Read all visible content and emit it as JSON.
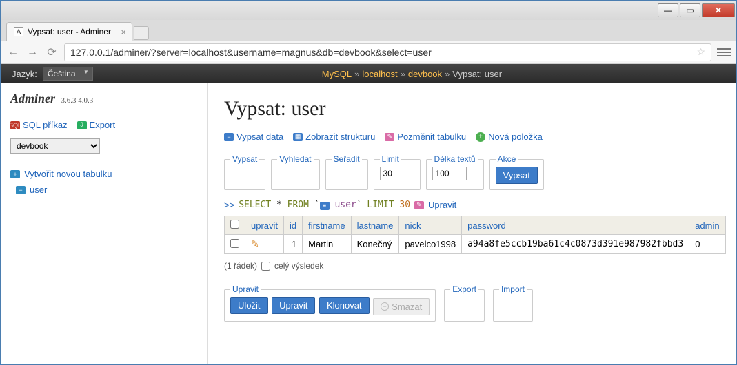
{
  "browser": {
    "tab_title": "Vypsat: user - Adminer",
    "url": "127.0.0.1/adminer/?server=localhost&username=magnus&db=devbook&select=user"
  },
  "topbar": {
    "lang_label": "Jazyk:",
    "lang_value": "Čeština",
    "crumb_mysql": "MySQL",
    "crumb_host": "localhost",
    "crumb_db": "devbook",
    "crumb_current": "Vypsat: user"
  },
  "sidebar": {
    "brand": "Adminer",
    "version": "3.6.3 4.0.3",
    "sql_link": "SQL příkaz",
    "export_link": "Export",
    "db_value": "devbook",
    "create_table": "Vytvořit novou tabulku",
    "table_user": "user"
  },
  "main": {
    "title": "Vypsat: user",
    "act_select": "Vypsat data",
    "act_structure": "Zobrazit strukturu",
    "act_alter": "Pozměnit tabulku",
    "act_new": "Nová položka",
    "fs_select": "Vypsat",
    "fs_search": "Vyhledat",
    "fs_sort": "Seřadit",
    "fs_limit_label": "Limit",
    "fs_limit_value": "30",
    "fs_textlen_label": "Délka textů",
    "fs_textlen_value": "100",
    "fs_action_label": "Akce",
    "fs_action_btn": "Vypsat",
    "sql_prompt": ">>",
    "sql_code_kw1": "SELECT",
    "sql_code_star": "*",
    "sql_code_kw2": "FROM",
    "sql_code_tbl": "user",
    "sql_code_kw3": "LIMIT",
    "sql_code_num": "30",
    "sql_edit": "Upravit",
    "cols": {
      "edit": "upravit",
      "id": "id",
      "firstname": "firstname",
      "lastname": "lastname",
      "nick": "nick",
      "password": "password",
      "admin": "admin"
    },
    "row": {
      "id": "1",
      "firstname": "Martin",
      "lastname": "Konečný",
      "nick": "pavelco1998",
      "password": "a94a8fe5ccb19ba61c4c0873d391e987982fbbd3",
      "admin": "0"
    },
    "result_count": "(1 řádek)",
    "result_whole": "celý výsledek",
    "edit_legend": "Upravit",
    "btn_save": "Uložit",
    "btn_edit": "Upravit",
    "btn_clone": "Klonovat",
    "btn_delete": "Smazat",
    "export_legend": "Export",
    "import_legend": "Import"
  },
  "chart_data": {
    "type": "table",
    "columns": [
      "id",
      "firstname",
      "lastname",
      "nick",
      "password",
      "admin"
    ],
    "rows": [
      [
        1,
        "Martin",
        "Konečný",
        "pavelco1998",
        "a94a8fe5ccb19ba61c4c0873d391e987982fbbd3",
        0
      ]
    ]
  }
}
